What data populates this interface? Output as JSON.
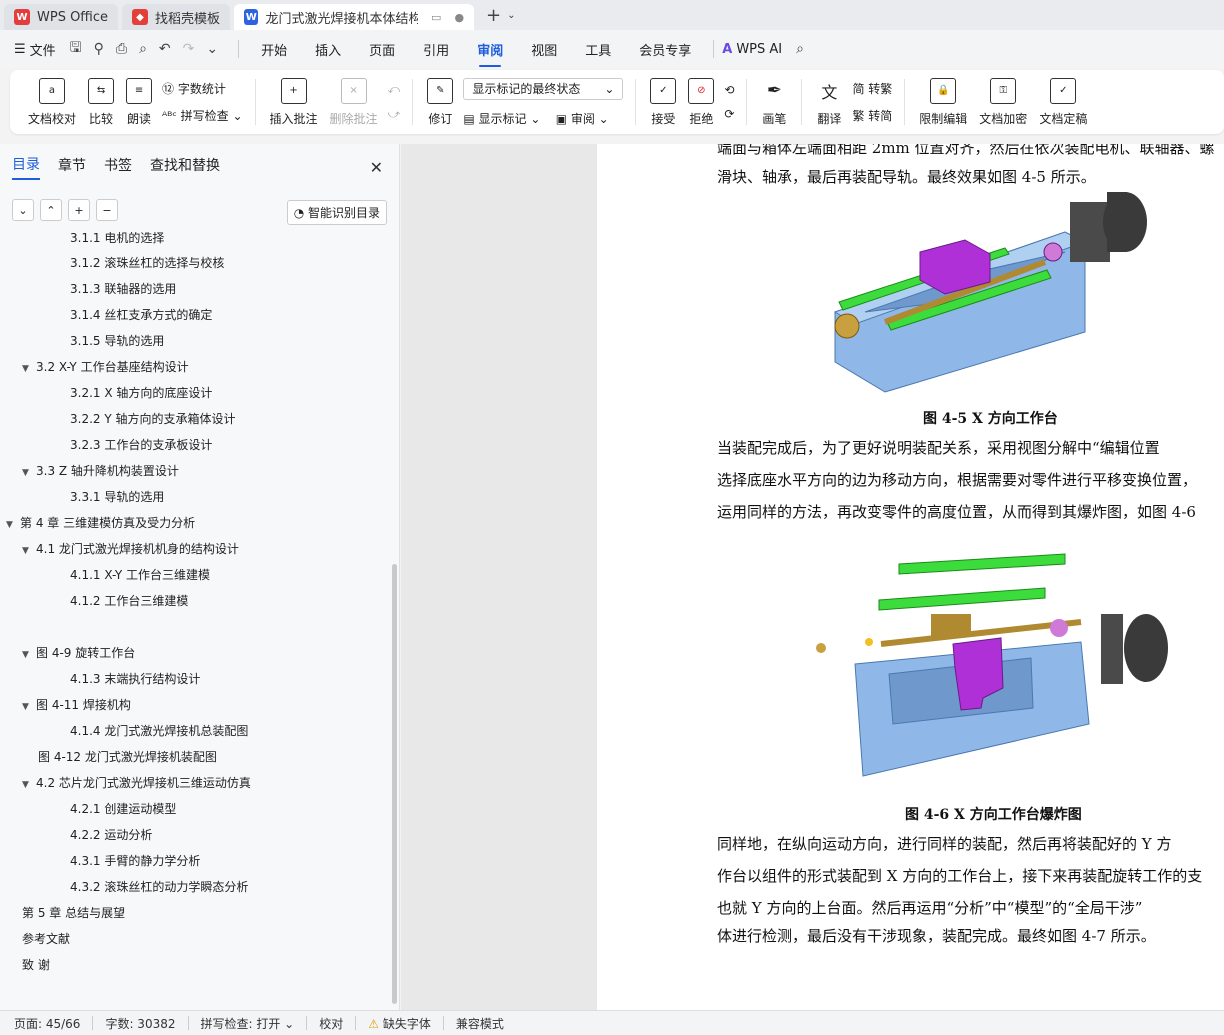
{
  "tabs": [
    {
      "label": "WPS Office"
    },
    {
      "label": "找稻壳模板"
    },
    {
      "label": "龙门式激光焊接机本体结构与"
    }
  ],
  "menubar": {
    "file": "文件",
    "tabs": [
      "开始",
      "插入",
      "页面",
      "引用",
      "审阅",
      "视图",
      "工具",
      "会员专享"
    ],
    "active_tab": "审阅",
    "ai": "WPS AI"
  },
  "ribbon": {
    "doc_check": "文档校对",
    "compare": "比较",
    "read_aloud": "朗读",
    "word_count": "字数统计",
    "spell_check": "拼写检查",
    "insert_comment": "插入批注",
    "delete_comment": "删除批注",
    "revise": "修订",
    "markup_select": "显示标记的最终状态",
    "show_markup": "显示标记",
    "review": "审阅",
    "accept": "接受",
    "reject": "拒绝",
    "pen": "画笔",
    "translate": "翻译",
    "to_traditional": "转繁",
    "to_simplified": "转简",
    "restrict_edit": "限制编辑",
    "encrypt": "文档加密",
    "finalize": "文档定稿"
  },
  "sidebar": {
    "tabs": [
      "目录",
      "章节",
      "书签",
      "查找和替换"
    ],
    "smart_button": "智能识别目录",
    "toc": [
      {
        "text": "3.1.1  电机的选择",
        "level": 3,
        "arrow": ""
      },
      {
        "text": "3.1.2 滚珠丝杠的选择与校核",
        "level": 3,
        "arrow": ""
      },
      {
        "text": "3.1.3  联轴器的选用",
        "level": 3,
        "arrow": ""
      },
      {
        "text": "3.1.4  丝杠支承方式的确定",
        "level": 3,
        "arrow": ""
      },
      {
        "text": "3.1.5  导轨的选用",
        "level": 3,
        "arrow": ""
      },
      {
        "text": "3.2   X-Y 工作台基座结构设计",
        "level": 2,
        "arrow": "▼"
      },
      {
        "text": "3.2.1   X 轴方向的底座设计",
        "level": 3,
        "arrow": ""
      },
      {
        "text": "3.2.2   Y 轴方向的支承箱体设计",
        "level": 3,
        "arrow": ""
      },
      {
        "text": "3.2.3    工作台的支承板设计",
        "level": 3,
        "arrow": ""
      },
      {
        "text": "3.3    Z 轴升降机构装置设计",
        "level": 2,
        "arrow": "▼"
      },
      {
        "text": "3.3.1  导轨的选用",
        "level": 3,
        "arrow": ""
      },
      {
        "text": "第 4 章  三维建模仿真及受力分析",
        "level": 1,
        "arrow": "▼"
      },
      {
        "text": "4.1  龙门式激光焊接机机身的结构设计",
        "level": 2,
        "arrow": "▼"
      },
      {
        "text": "4.1.1    X-Y 工作台三维建模",
        "level": 3,
        "arrow": ""
      },
      {
        "text": "4.1.2    工作台三维建模",
        "level": 3,
        "arrow": ""
      },
      {
        "text": "",
        "level": 3,
        "arrow": ""
      },
      {
        "text": "图 4-9     旋转工作台",
        "level": 2,
        "arrow": "▼"
      },
      {
        "text": "4.1.3    末端执行结构设计",
        "level": 3,
        "arrow": ""
      },
      {
        "text": "图 4-11      焊接机构",
        "level": 2,
        "arrow": "▼"
      },
      {
        "text": "4.1.4    龙门式激光焊接机总装配图",
        "level": 3,
        "arrow": ""
      },
      {
        "text": "图 4-12     龙门式激光焊接机装配图",
        "level": 2,
        "arrow": ""
      },
      {
        "text": "4.2  芯片龙门式激光焊接机三维运动仿真",
        "level": 2,
        "arrow": "▼"
      },
      {
        "text": "4.2.1  创建运动模型",
        "level": 3,
        "arrow": ""
      },
      {
        "text": "4.2.2  运动分析",
        "level": 3,
        "arrow": ""
      },
      {
        "text": "4.3.1  手臂的静力学分析",
        "level": 3,
        "arrow": ""
      },
      {
        "text": "4.3.2  滚珠丝杠的动力学瞬态分析",
        "level": 3,
        "arrow": ""
      },
      {
        "text": "第 5 章  总结与展望",
        "level": 1,
        "arrow": ""
      },
      {
        "text": "参考文献",
        "level": 1,
        "arrow": ""
      },
      {
        "text": "致    谢",
        "level": 1,
        "arrow": ""
      }
    ]
  },
  "document": {
    "lines_top": [
      "端面与箱体左端面相距 2mm 位置对齐，然后在依次装配电机、联轴器、螺",
      "滑块、轴承，最后再装配导轨。最终效果如图 4-5 所示。"
    ],
    "fig1_caption": "图 4-5    X 方向工作台",
    "lines_mid": [
      "    当装配完成后，为了更好说明装配关系，采用视图分解中“编辑位置",
      "选择底座水平方向的边为移动方向，根据需要对零件进行平移变换位置，",
      "运用同样的方法，再改变零件的高度位置，从而得到其爆炸图，如图 4-6"
    ],
    "fig2_caption": "图 4-6    X 方向工作台爆炸图",
    "lines_bottom": [
      "    同样地，在纵向运动方向，进行同样的装配，然后再将装配好的 Y 方",
      "作台以组件的形式装配到 X 方向的工作台上，接下来再装配旋转工作的支",
      "也就 Y 方向的上台面。然后再运用“分析”中“模型”的“全局干涉”",
      "体进行检测，最后没有干涉现象，装配完成。最终如图 4-7 所示。"
    ]
  },
  "status": {
    "page": "页面: 45/66",
    "words": "字数: 30382",
    "spell": "拼写检查: 打开",
    "proof": "校对",
    "missing_font": "缺失字体",
    "compat": "兼容模式"
  },
  "colors": {
    "accent": "#1e5ddc",
    "model_blue": "#8fb8e8",
    "rail_green": "#3ddc3d",
    "slider_purple": "#b030d8",
    "screw_gold": "#b08a30"
  }
}
